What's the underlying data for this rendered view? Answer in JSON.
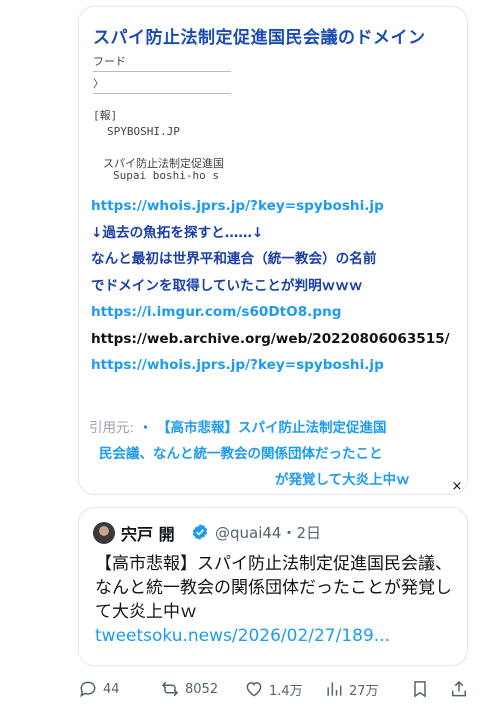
{
  "card": {
    "title": "スパイ防止法制定促進国民会議のドメイン",
    "whois": {
      "label1": "フード",
      "label2": "〉",
      "label3": "[報]",
      "domain": "SPYBOSHI.JP",
      "jp_name": "スパイ防止法制定促進国",
      "romaji": "Supai boshi-ho s"
    },
    "lines": [
      {
        "text": "https://whois.jprs.jp/?key=spyboshi.jp",
        "style": "link"
      },
      {
        "text": "↓過去の魚拓を探すと……↓",
        "style": "blue"
      },
      {
        "text": "なんと最初は世界平和連合（統一教会）の名前",
        "style": "blue"
      },
      {
        "text": "でドメインを取得していたことが判明ｗｗｗ",
        "style": "blue"
      },
      {
        "text": "https://i.imgur.com/s60DtO8.png",
        "style": "link"
      },
      {
        "text": "https://web.archive.org/web/20220806063515/",
        "style": "dark"
      },
      {
        "text": "https://whois.jprs.jp/?key=spyboshi.jp",
        "style": "link"
      }
    ],
    "citation": {
      "label": "引用元:",
      "bullet": "・",
      "line1": "【高市悲報】スパイ防止法制定促進国",
      "line2": "民会議、なんと統一教会の関係団体だったこと",
      "line3": "が発覚して大炎上中ｗ"
    }
  },
  "close_glyph": "×",
  "quote": {
    "name": "宍戸 開",
    "handle_time": "@quai44・2日",
    "text": "【高市悲報】スパイ防止法制定促進国民会議、なんと統一教会の関係団体だったことが発覚して大炎上中ｗ",
    "link": "tweetsoku.news/2026/02/27/189..."
  },
  "actions": {
    "replies": "44",
    "reposts": "8052",
    "likes": "1.4万",
    "views": "27万"
  },
  "colors": {
    "link": "#1d9bf0",
    "title_blue": "#1a4db3",
    "muted": "#536471"
  }
}
